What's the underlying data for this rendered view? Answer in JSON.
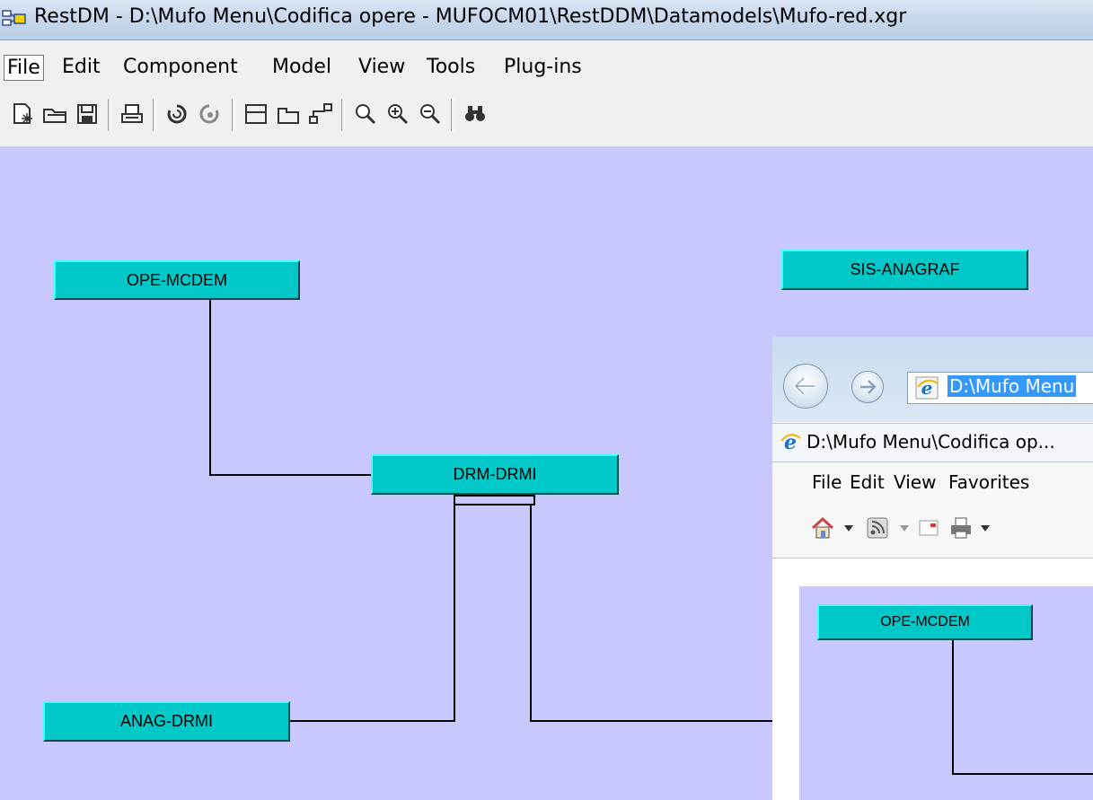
{
  "window": {
    "title": "RestDM - D:\\Mufo Menu\\Codifica opere - MUFOCM01\\RestDDM\\Datamodels\\Mufo-red.xgr"
  },
  "menu": {
    "file": "File",
    "edit": "Edit",
    "component": "Component",
    "model": "Model",
    "view": "View",
    "tools": "Tools",
    "plugins": "Plug-ins"
  },
  "toolbar": {
    "icons": [
      "new-icon",
      "open-icon",
      "save-icon",
      "print-icon",
      "undo-icon",
      "redo-icon",
      "entity-icon",
      "view-icon",
      "relation-icon",
      "zoom-icon",
      "zoom-in-icon",
      "zoom-out-icon",
      "find-icon"
    ]
  },
  "diagram": {
    "entities": {
      "ope_mcdem": "OPE-MCDEM",
      "sis_anagraf": "SIS-ANAGRAF",
      "drm_drmi": "DRM-DRMI",
      "anag_drmi": "ANAG-DRMI"
    }
  },
  "browser": {
    "address": "D:\\Mufo Menu",
    "tab_title": "D:\\Mufo Menu\\Codifica op...",
    "menu": {
      "file": "File",
      "edit": "Edit",
      "view": "View",
      "favorites": "Favorites"
    },
    "embedded_entity": "OPE-MCDEM"
  },
  "colors": {
    "canvas": "#c8c8ff",
    "entity_fill": "#00c8c8",
    "selection": "#3399ff"
  }
}
